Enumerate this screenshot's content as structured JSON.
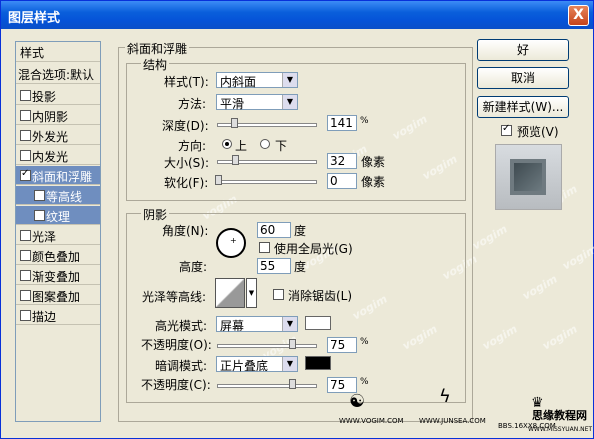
{
  "window": {
    "title": "图层样式",
    "close_glyph": "X"
  },
  "style_list": {
    "header": "样式",
    "blend": "混合选项:默认",
    "items": [
      {
        "label": "投影",
        "checked": false,
        "selected": false,
        "indent": false
      },
      {
        "label": "内阴影",
        "checked": false,
        "selected": false,
        "indent": false
      },
      {
        "label": "外发光",
        "checked": false,
        "selected": false,
        "indent": false
      },
      {
        "label": "内发光",
        "checked": false,
        "selected": false,
        "indent": false
      },
      {
        "label": "斜面和浮雕",
        "checked": true,
        "selected": true,
        "indent": false
      },
      {
        "label": "等高线",
        "checked": false,
        "selected": true,
        "indent": true
      },
      {
        "label": "纹理",
        "checked": false,
        "selected": true,
        "indent": true
      },
      {
        "label": "光泽",
        "checked": false,
        "selected": false,
        "indent": false
      },
      {
        "label": "颜色叠加",
        "checked": false,
        "selected": false,
        "indent": false
      },
      {
        "label": "渐变叠加",
        "checked": false,
        "selected": false,
        "indent": false
      },
      {
        "label": "图案叠加",
        "checked": false,
        "selected": false,
        "indent": false
      },
      {
        "label": "描边",
        "checked": false,
        "selected": false,
        "indent": false
      }
    ]
  },
  "bevel": {
    "title": "斜面和浮雕",
    "structure": {
      "title": "结构",
      "style_label": "样式(T):",
      "style_value": "内斜面",
      "technique_label": "方法:",
      "technique_value": "平滑",
      "depth_label": "深度(D):",
      "depth_value": "141",
      "depth_unit": "%",
      "direction_label": "方向:",
      "dir_up": "上",
      "dir_down": "下",
      "size_label": "大小(S):",
      "size_value": "32",
      "size_unit": "像素",
      "soften_label": "软化(F):",
      "soften_value": "0",
      "soften_unit": "像素"
    },
    "shading": {
      "title": "阴影",
      "angle_label": "角度(N):",
      "angle_value": "60",
      "angle_unit": "度",
      "global_light_label": "使用全局光(G)",
      "altitude_label": "高度:",
      "altitude_value": "55",
      "altitude_unit": "度",
      "gloss_label": "光泽等高线:",
      "antialias_label": "消除锯齿(L)",
      "highlight_label": "高光模式:",
      "highlight_value": "屏幕",
      "highlight_color": "#ffffff",
      "opacity1_label": "不透明度(O):",
      "opacity1_value": "75",
      "opacity1_unit": "%",
      "shadow_label": "暗调模式:",
      "shadow_value": "正片叠底",
      "shadow_color": "#000000",
      "opacity2_label": "不透明度(C):",
      "opacity2_value": "75",
      "opacity2_unit": "%"
    }
  },
  "buttons": {
    "ok": "好",
    "cancel": "取消",
    "new_style": "新建样式(W)...",
    "preview": "预览(V)"
  },
  "watermarks": {
    "text": "vogim",
    "footer1": "WWW.VOGIM.COM",
    "footer2": "WWW.JUNSEA.COM",
    "footer3": "BBS.16XX8.COM",
    "site_cn": "思缘教程网",
    "site_en": "WWW.MISSYUAN.NET"
  }
}
